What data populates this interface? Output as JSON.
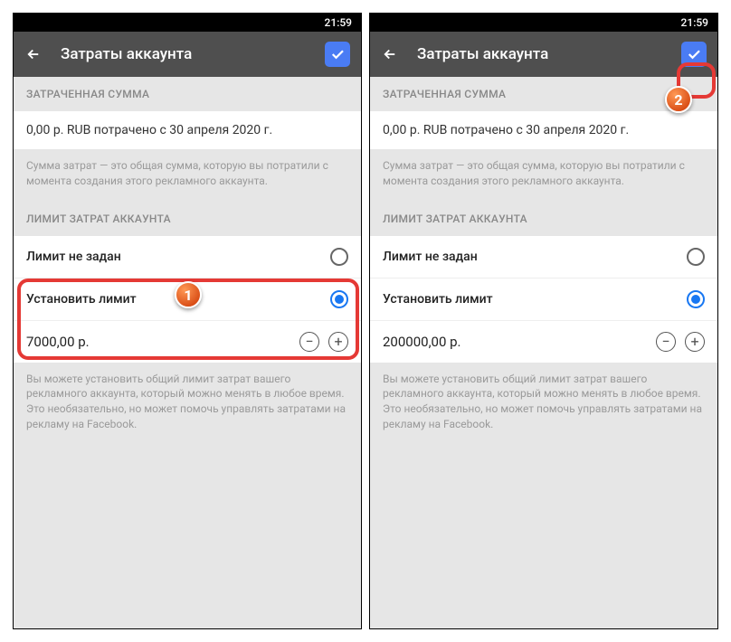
{
  "statusbar": {
    "time": "21:59"
  },
  "header": {
    "title": "Затраты аккаунта"
  },
  "spent_section": {
    "header": "ЗАТРАЧЕННАЯ СУММА",
    "value": "0,00 р. RUB потрачено с 30 апреля 2020 г.",
    "desc": "Сумма затрат — это общая сумма, которую вы потратили с момента создания этого рекламного аккаунта."
  },
  "limit_section": {
    "header": "ЛИМИТ ЗАТРАТ АККАУНТА",
    "no_limit_label": "Лимит не задан",
    "set_limit_label": "Установить лимит",
    "desc": "Вы можете установить общий лимит затрат вашего рекламного аккаунта, который можно менять в любое время. Это необязательно, но может помочь управлять затратами на рекламу на Facebook."
  },
  "screens": [
    {
      "limit_value": "7000,00 р."
    },
    {
      "limit_value": "200000,00 р."
    }
  ],
  "markers": {
    "one": "1",
    "two": "2"
  }
}
